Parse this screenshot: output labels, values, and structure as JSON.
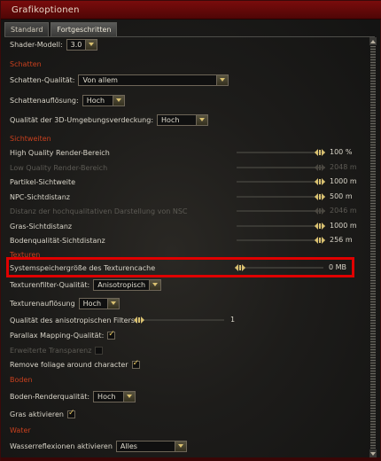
{
  "window": {
    "title": "Grafikoptionen"
  },
  "tabs": [
    {
      "label": "Standard",
      "active": false
    },
    {
      "label": "Fortgeschritten",
      "active": true
    }
  ],
  "settings": {
    "shader_model": {
      "label": "Shader-Modell:",
      "value": "3.0"
    },
    "section_schatten": "Schatten",
    "schatten_qualitaet": {
      "label": "Schatten-Qualität:",
      "value": "Von allem"
    },
    "schattenaufloesung": {
      "label": "Schattenauflösung:",
      "value": "Hoch"
    },
    "ambient_occlusion": {
      "label": "Qualität der 3D-Umgebungsverdeckung:",
      "value": "Hoch"
    },
    "section_sichtweiten": "Sichtweiten",
    "high_quality_render": {
      "label": "High Quality Render-Bereich",
      "value": "100 %",
      "level": 1.0
    },
    "low_quality_render": {
      "label": "Low Quality Render-Bereich",
      "value": "2048 m",
      "level": 1.0,
      "disabled": true
    },
    "partikel_sichtweite": {
      "label": "Partikel-Sichtweite",
      "value": "1000 m",
      "level": 1.0
    },
    "npc_sichtdistanz": {
      "label": "NPC-Sichtdistanz",
      "value": "500 m",
      "level": 1.0
    },
    "distanz_npc_hq": {
      "label": "Distanz der hochqualitativen Darstellung von NSC",
      "value": "2046 m",
      "level": 1.0,
      "disabled": true
    },
    "gras_sichtdistanz": {
      "label": "Gras-Sichtdistanz",
      "value": "1000 m",
      "level": 1.0
    },
    "bodenqualitaet_sichtdistanz": {
      "label": "Bodenqualität-Sichtdistanz",
      "value": "256 m",
      "level": 1.0
    },
    "section_texturen": "Texturen",
    "texturcache": {
      "label": "Systemspeichergröße des Texturencache",
      "value": "0 MB",
      "level": 0.0
    },
    "texturfilter_qualitaet": {
      "label": "Texturenfilter-Qualität:",
      "value": "Anisotropisch"
    },
    "texturaufloesung": {
      "label": "Texturenauflösung",
      "value": "Hoch"
    },
    "anisotropic_filter": {
      "label": "Qualität des anisotropischen Filters:",
      "value": "1",
      "level": 0.0
    },
    "parallax_mapping": {
      "label": "Parallax Mapping-Qualität:",
      "checked": true
    },
    "erweiterte_transparenz": {
      "label": "Erweiterte Transparenz",
      "checked": false,
      "disabled": true
    },
    "remove_foliage": {
      "label": "Remove foliage around character",
      "checked": true
    },
    "section_boden": "Boden",
    "boden_renderqualitaet": {
      "label": "Boden-Renderqualität:",
      "value": "Hoch"
    },
    "gras_aktivieren": {
      "label": "Gras aktivieren",
      "checked": true
    },
    "section_water": "Water",
    "wasserreflexionen": {
      "label": "Wasserreflexionen aktivieren",
      "value": "Alles"
    }
  },
  "colors": {
    "section": "#c8401e",
    "title_bar": "#6a0a0a",
    "highlight": "#e00000",
    "knob": "#d8c070"
  }
}
